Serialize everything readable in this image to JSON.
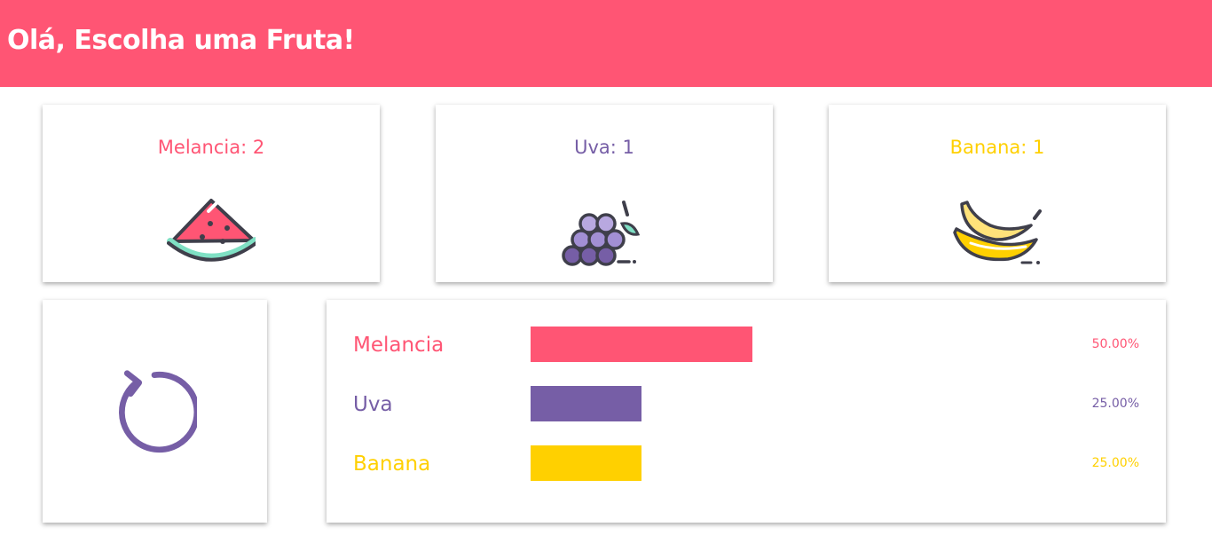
{
  "header": {
    "title": "Olá, Escolha uma Fruta!"
  },
  "colors": {
    "brand": "#ff5574",
    "melancia": "#ff5574",
    "uva": "#765ea6",
    "banana": "#ffd000"
  },
  "fruits": [
    {
      "label": "Melancia: 2",
      "icon": "watermelon-icon"
    },
    {
      "label": "Uva: 1",
      "icon": "grapes-icon"
    },
    {
      "label": "Banana: 1",
      "icon": "banana-icon"
    }
  ],
  "reset": {
    "icon": "reset-icon"
  },
  "stats": [
    {
      "name": "Melancia",
      "percent_label": "50.00%",
      "fraction": 0.5
    },
    {
      "name": "Uva",
      "percent_label": "25.00%",
      "fraction": 0.25
    },
    {
      "name": "Banana",
      "percent_label": "25.00%",
      "fraction": 0.25
    }
  ]
}
